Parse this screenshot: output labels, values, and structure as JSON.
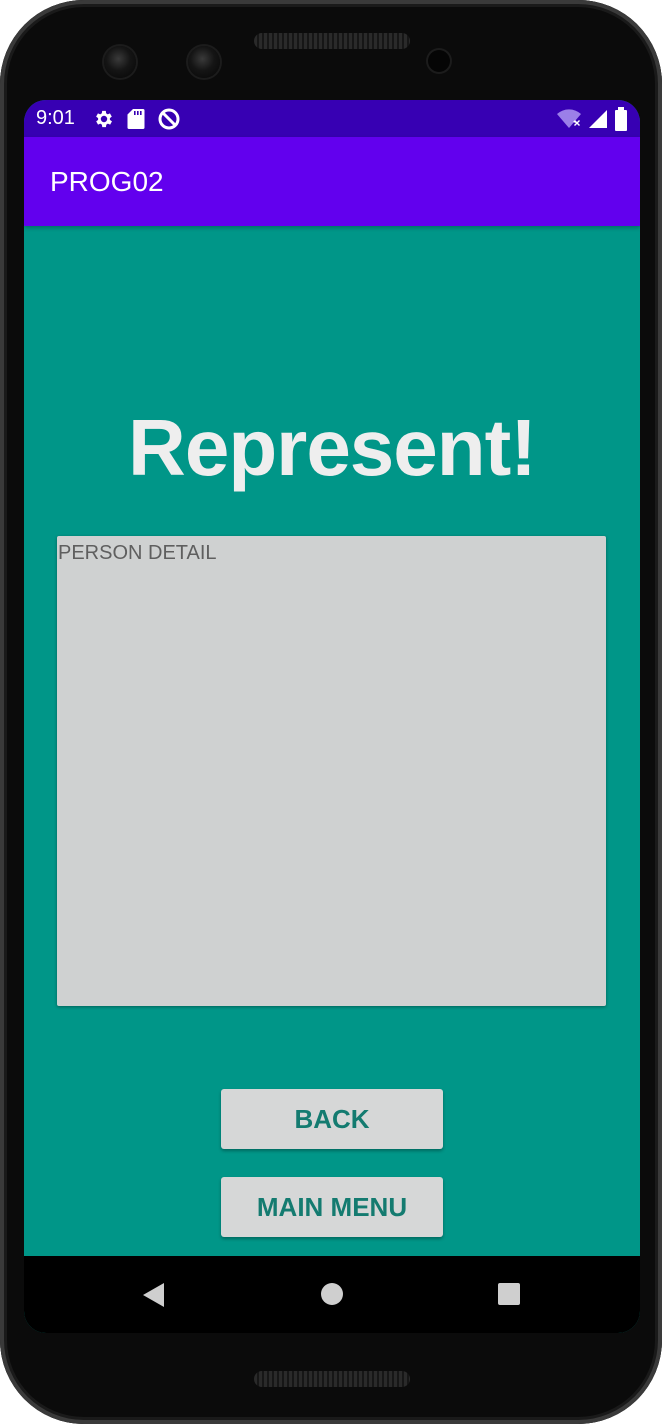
{
  "status_bar": {
    "time": "9:01",
    "left_icons": [
      "gear-icon",
      "sd-card-icon",
      "data-saver-icon"
    ],
    "right_icons": [
      "wifi-off-icon",
      "signal-icon",
      "battery-icon"
    ]
  },
  "app_bar": {
    "title": "PROG02"
  },
  "main": {
    "headline": "Represent!",
    "detail_text": "PERSON DETAIL"
  },
  "buttons": {
    "back_label": "BACK",
    "main_menu_label": "MAIN MENU"
  },
  "nav_bar": {
    "icons": [
      "back-triangle-icon",
      "home-circle-icon",
      "recents-square-icon"
    ]
  },
  "colors": {
    "status_bar": "#3700b3",
    "app_bar": "#6200ee",
    "background": "#009688",
    "detail_box": "#cfd1d1",
    "button_text": "#147b70"
  }
}
